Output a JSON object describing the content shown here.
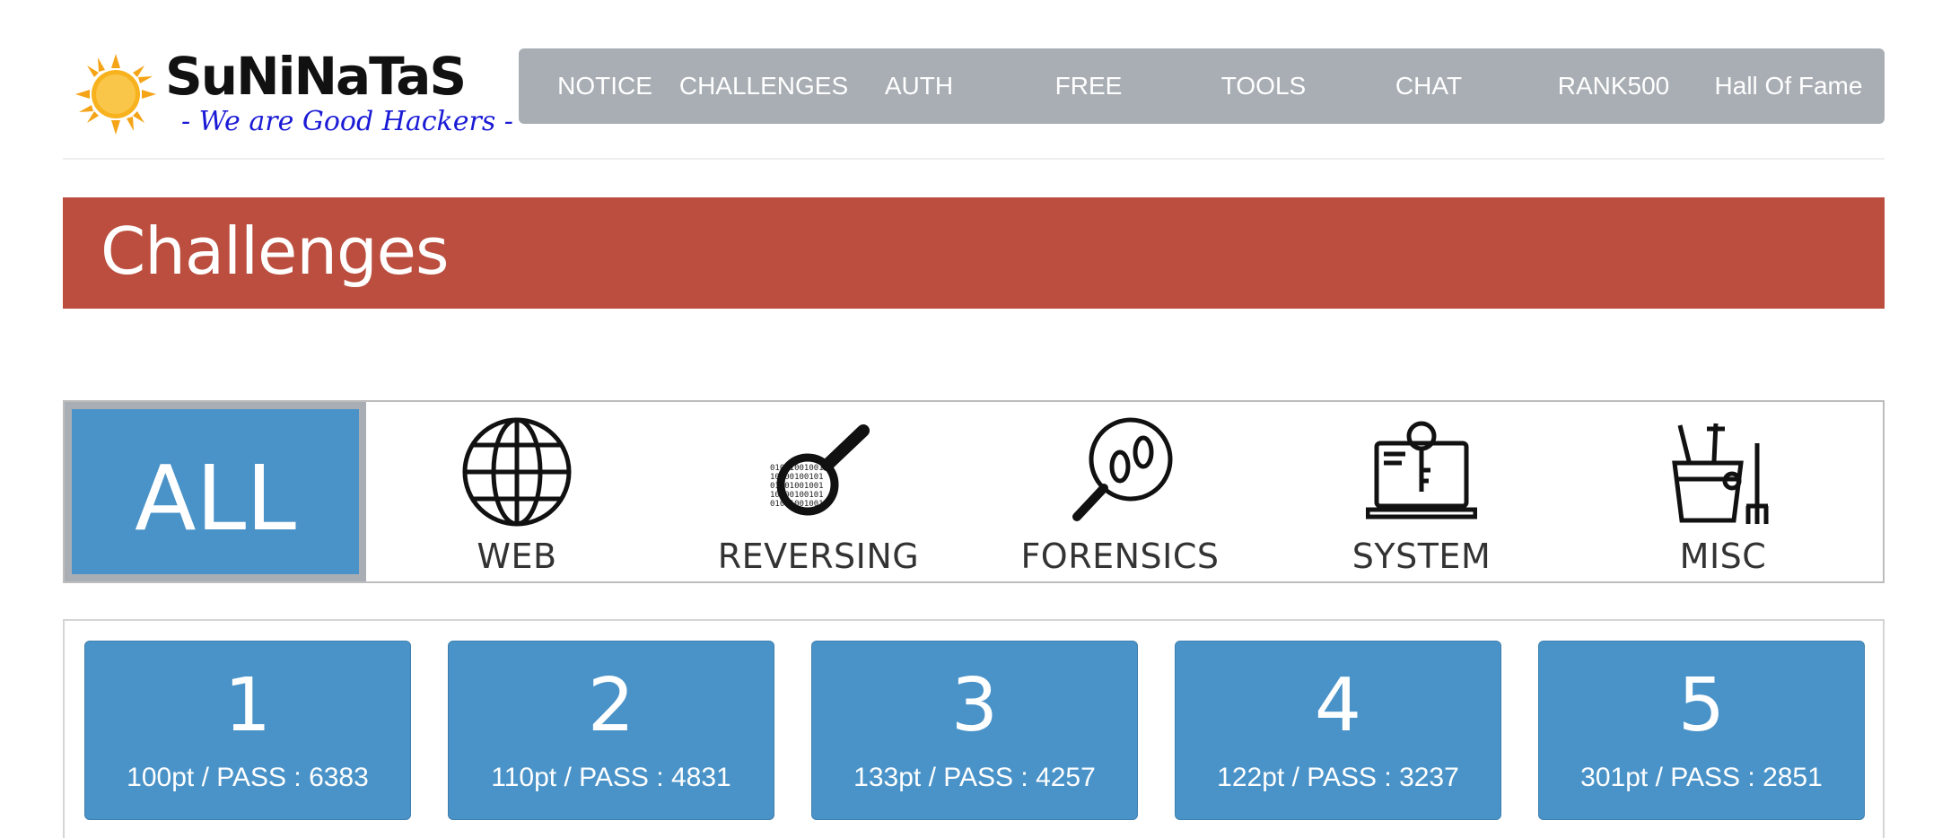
{
  "logo": {
    "title": "SuNiNaTaS",
    "tagline": "- We are Good Hackers -"
  },
  "nav": {
    "items": [
      "NOTICE",
      "CHALLENGES",
      "AUTH",
      "FREE",
      "TOOLS",
      "CHAT",
      "RANK500",
      "Hall Of Fame"
    ]
  },
  "page": {
    "title": "Challenges"
  },
  "categories": {
    "all": "ALL",
    "items": [
      {
        "label": "WEB",
        "icon": "globe-icon"
      },
      {
        "label": "REVERSING",
        "icon": "binary-magnifier-icon"
      },
      {
        "label": "FORENSICS",
        "icon": "footprint-magnifier-icon"
      },
      {
        "label": "SYSTEM",
        "icon": "laptop-key-icon"
      },
      {
        "label": "MISC",
        "icon": "bucket-tools-icon"
      }
    ]
  },
  "challenges": [
    {
      "number": "1",
      "meta": "100pt / PASS : 6383"
    },
    {
      "number": "2",
      "meta": "110pt / PASS : 4831"
    },
    {
      "number": "3",
      "meta": "133pt / PASS : 4257"
    },
    {
      "number": "4",
      "meta": "122pt / PASS : 3237"
    },
    {
      "number": "5",
      "meta": "301pt / PASS : 2851"
    }
  ],
  "colors": {
    "nav_bg": "#a9aeb4",
    "banner_bg": "#bb4e3e",
    "tile_bg": "#4a93c8"
  }
}
